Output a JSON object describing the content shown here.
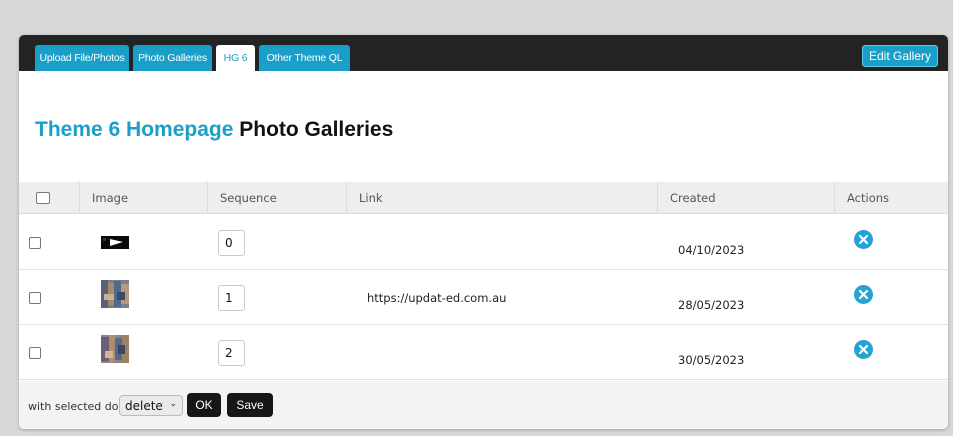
{
  "tabs": [
    {
      "label": "Upload File/Photos",
      "active": false
    },
    {
      "label": "Photo Galleries",
      "active": false
    },
    {
      "label": "HG 6",
      "active": true
    },
    {
      "label": "Other Theme QL",
      "active": false
    }
  ],
  "edit_gallery_label": "Edit Gallery",
  "page_title": {
    "accent": "Theme 6 Homepage",
    "rest": " Photo Galleries"
  },
  "columns": [
    "Image",
    "Sequence",
    "Link",
    "Created",
    "Actions"
  ],
  "rows": [
    {
      "image": "play-thumbnail",
      "sequence": "0",
      "link": "",
      "created": "04/10/2023",
      "action_icon": "delete-icon"
    },
    {
      "image": "photo-thumbnail",
      "sequence": "1",
      "link": "https://updat-ed.com.au",
      "created": "28/05/2023",
      "action_icon": "delete-icon"
    },
    {
      "image": "photo-thumbnail",
      "sequence": "2",
      "link": "",
      "created": "30/05/2023",
      "action_icon": "delete-icon"
    }
  ],
  "footer": {
    "label": "with selected do:",
    "select_value": "delete",
    "ok_label": "OK",
    "save_label": "Save"
  },
  "colors": {
    "accent": "#1aa0c8",
    "topbar": "#232323"
  }
}
